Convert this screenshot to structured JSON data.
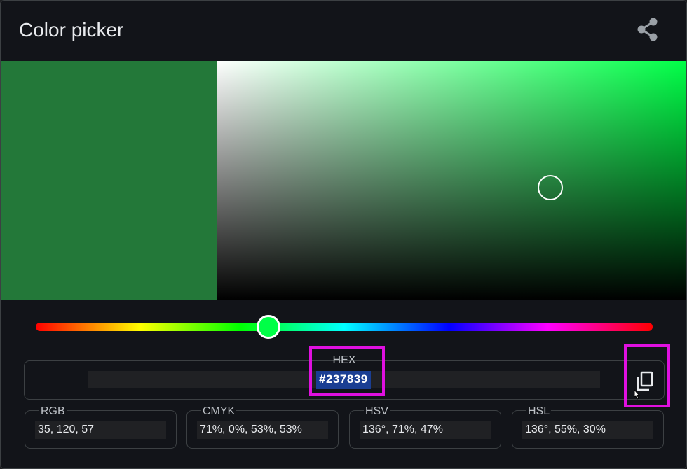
{
  "header": {
    "title": "Color picker",
    "share_icon": "share-icon"
  },
  "color": {
    "hex_value": "#237839",
    "hue_hex": "#00ff47",
    "preview_hex": "#237839",
    "hue_degrees": 136,
    "saturation_percent": 71,
    "value_percent": 47
  },
  "hex_field": {
    "label": "HEX",
    "value": "#237839",
    "copy_icon": "copy-icon"
  },
  "fields": [
    {
      "label": "RGB",
      "value": "35, 120, 57"
    },
    {
      "label": "CMYK",
      "value": "71%, 0%, 53%, 53%"
    },
    {
      "label": "HSV",
      "value": "136°, 71%, 47%"
    },
    {
      "label": "HSL",
      "value": "136°, 55%, 30%"
    }
  ],
  "colors": {
    "background": "#121419",
    "highlight": "#e010e0",
    "selection": "#1a3e93"
  }
}
